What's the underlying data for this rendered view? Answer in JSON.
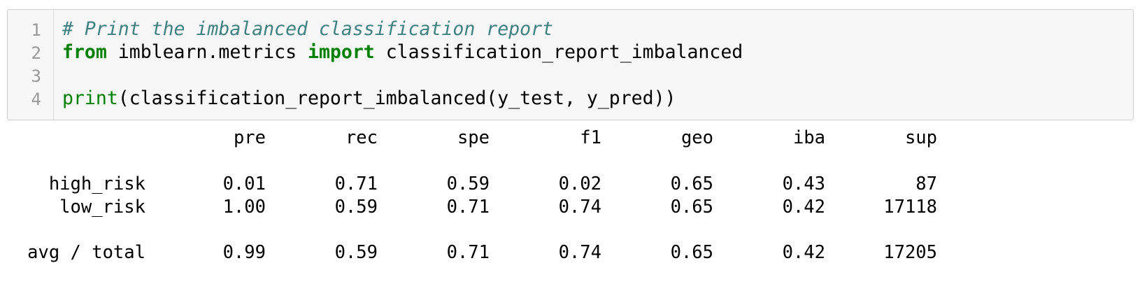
{
  "code_cell": {
    "line_numbers": [
      "1",
      "2",
      "3",
      "4"
    ],
    "line1_comment": "# Print the imbalanced classification report",
    "line2_from": "from",
    "line2_module": " imblearn.metrics ",
    "line2_import": "import",
    "line2_name": " classification_report_imbalanced",
    "line4_print": "print",
    "line4_args": "(classification_report_imbalanced(y_test, y_pred))"
  },
  "report": {
    "headers": [
      "pre",
      "rec",
      "spe",
      "f1",
      "geo",
      "iba",
      "sup"
    ],
    "rows": [
      {
        "label": "high_risk",
        "values": [
          "0.01",
          "0.71",
          "0.59",
          "0.02",
          "0.65",
          "0.43",
          "87"
        ]
      },
      {
        "label": "low_risk",
        "values": [
          "1.00",
          "0.59",
          "0.71",
          "0.74",
          "0.65",
          "0.42",
          "17118"
        ]
      }
    ],
    "total": {
      "label": "avg / total",
      "values": [
        "0.99",
        "0.59",
        "0.71",
        "0.74",
        "0.65",
        "0.42",
        "17205"
      ]
    }
  },
  "colors": {
    "comment": "#408080",
    "keyword": "#008000",
    "cell_background": "#f7f7f7",
    "line_number": "#999999"
  }
}
